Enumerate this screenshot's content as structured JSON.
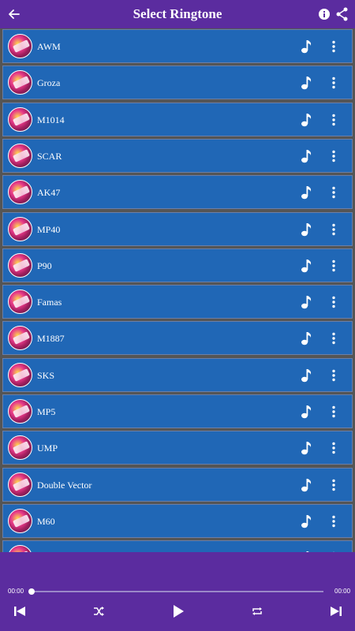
{
  "appbar": {
    "title": "Select Ringtone",
    "back_icon": "arrow-back-icon",
    "info_icon": "info-icon",
    "share_icon": "share-icon",
    "background": "#5b2c9f"
  },
  "list": {
    "row_color": "#2067b6",
    "items": [
      {
        "label": "AWM"
      },
      {
        "label": "Groza"
      },
      {
        "label": "M1014"
      },
      {
        "label": "SCAR"
      },
      {
        "label": "AK47"
      },
      {
        "label": "MP40"
      },
      {
        "label": "P90"
      },
      {
        "label": "Famas"
      },
      {
        "label": "M1887"
      },
      {
        "label": "SKS"
      },
      {
        "label": "MP5"
      },
      {
        "label": "UMP"
      },
      {
        "label": "Double Vector"
      },
      {
        "label": "M60"
      },
      {
        "label": ""
      }
    ]
  },
  "player": {
    "elapsed": "00:00",
    "duration": "00:00",
    "progress": 0,
    "controls": [
      "skip-previous-icon",
      "shuffle-icon",
      "play-icon",
      "repeat-icon",
      "skip-next-icon"
    ]
  }
}
